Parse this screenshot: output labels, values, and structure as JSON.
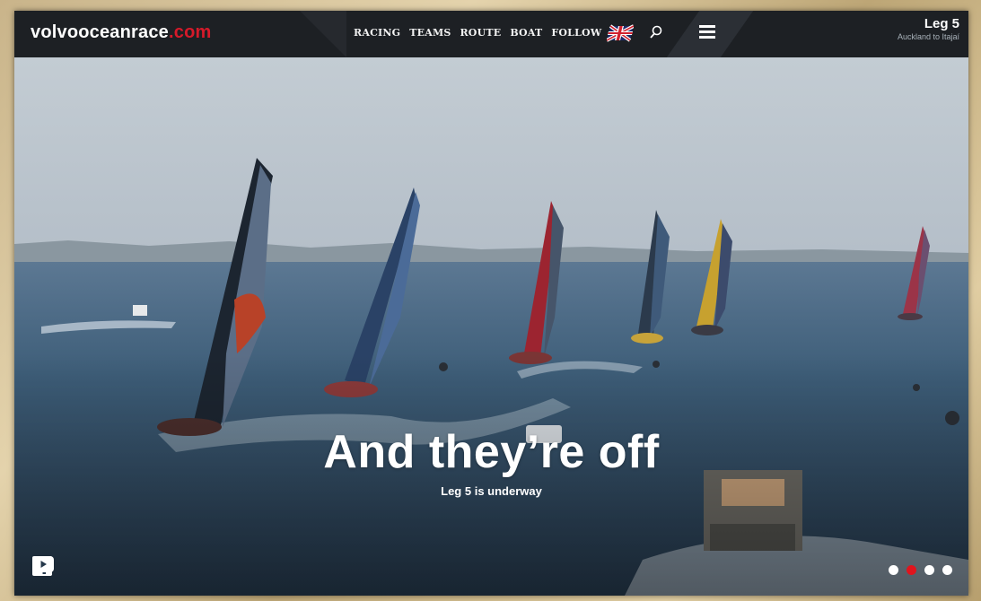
{
  "header": {
    "logo_main": "volvooceanrace",
    "logo_suffix": ".com",
    "nav": [
      "RACING",
      "TEAMS",
      "ROUTE",
      "BOAT",
      "FOLLOW"
    ],
    "leg_title": "Leg 5",
    "leg_subtitle": "Auckland to Itajaí"
  },
  "hero": {
    "headline": "And they’re off",
    "subheadline": "Leg 5 is underway"
  },
  "social": [
    "bell-icon",
    "twitter-icon",
    "facebook-icon",
    "instagram-icon",
    "youtube-icon"
  ],
  "carousel": {
    "count": 4,
    "active_index": 2
  },
  "colors": {
    "brand_red": "#d51a2a",
    "header_bg": "#1d2024",
    "sea": "#3d5d78"
  }
}
